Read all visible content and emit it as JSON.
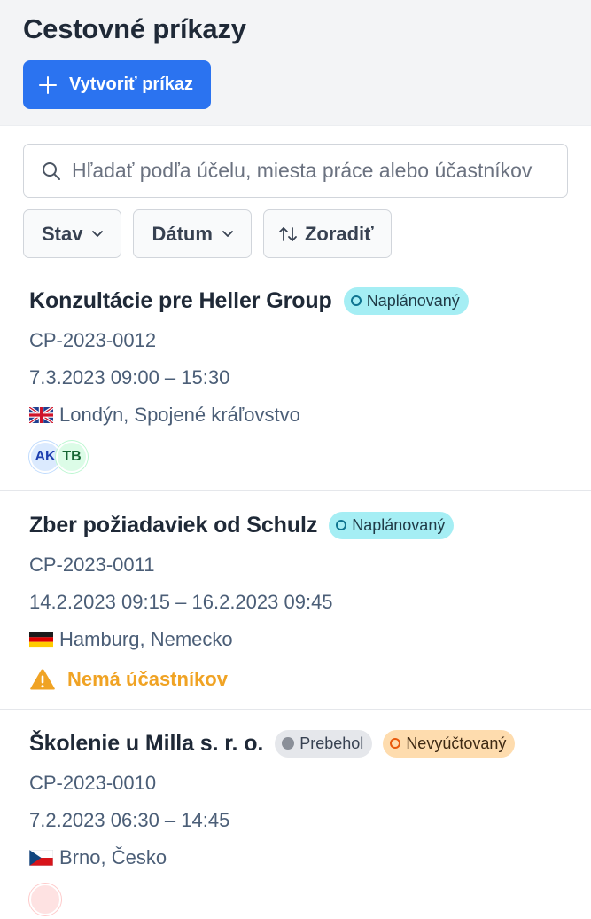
{
  "header": {
    "title": "Cestovné príkazy",
    "create_label": "Vytvoriť príkaz"
  },
  "search": {
    "placeholder": "Hľadať podľa účelu, miesta práce alebo účastníkov"
  },
  "filters": {
    "status": "Stav",
    "date": "Dátum",
    "sort": "Zoradiť"
  },
  "orders": [
    {
      "title": "Konzultácie pre Heller Group",
      "badges": [
        "Naplánovaný"
      ],
      "id": "CP-2023-0012",
      "dates": "7.3.2023 09:00 – 15:30",
      "location": "Londýn, Spojené kráľovstvo",
      "flag": "gb-flag-icon",
      "participants": [
        "AK",
        "TB"
      ]
    },
    {
      "title": "Zber požiadaviek od Schulz",
      "badges": [
        "Naplánovaný"
      ],
      "id": "CP-2023-0011",
      "dates": "14.2.2023 09:15 – 16.2.2023 09:45",
      "location": "Hamburg, Nemecko",
      "flag": "de-flag-icon",
      "warning": "Nemá účastníkov"
    },
    {
      "title": "Školenie u Milla s. r. o.",
      "badges": [
        "Prebehol",
        "Nevyúčtovaný"
      ],
      "id": "CP-2023-0010",
      "dates": "7.2.2023 06:30 – 14:45",
      "location": "Brno, Česko",
      "flag": "cz-flag-icon"
    }
  ],
  "colors": {
    "primary": "#2b73f0",
    "planned_badge": "#a5eef4",
    "done_badge": "#e5e7eb",
    "unbilled_badge": "#fedcae",
    "warning": "#f0a324"
  }
}
